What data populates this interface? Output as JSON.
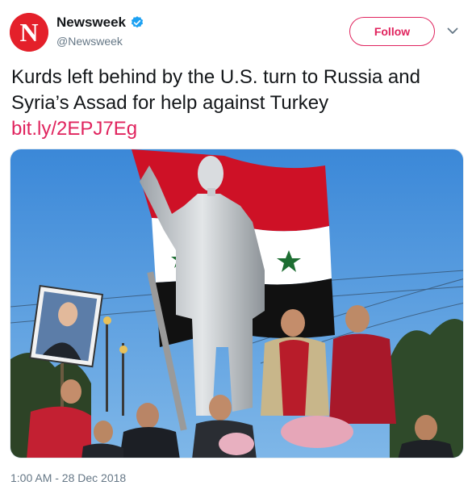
{
  "account": {
    "display_name": "Newsweek",
    "handle": "@Newsweek",
    "avatar_letter": "N",
    "verified": true
  },
  "follow_button_label": "Follow",
  "tweet": {
    "text": "Kurds left behind by the U.S. turn to Russia and Syria’s Assad for help against Turkey",
    "link": "bit.ly/2EPJ7Eg"
  },
  "timestamp": "1:00 AM - 28 Dec 2018",
  "colors": {
    "brand_red": "#e4202a",
    "follow_accent": "#e0245e",
    "verified_blue": "#1da1f2",
    "secondary_text": "#657786"
  },
  "icons": {
    "verified": "verified-badge-icon",
    "more": "chevron-down-icon"
  }
}
